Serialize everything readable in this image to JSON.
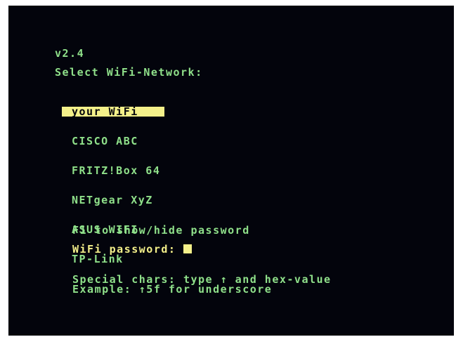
{
  "version": "v2.4",
  "heading": "Select WiFi-Network:",
  "networks": [
    {
      "name": "your WiFi",
      "selected": true
    },
    {
      "name": "CISCO ABC",
      "selected": false
    },
    {
      "name": "FRITZ!Box 64",
      "selected": false
    },
    {
      "name": "NETgear XyZ",
      "selected": false
    },
    {
      "name": "ASUS WIFI",
      "selected": false
    },
    {
      "name": "TP-Link",
      "selected": false
    }
  ],
  "hint_toggle": "F1 to show/hide password",
  "password_label": "WiFi password:",
  "password_value": "",
  "help_line_1": "Special chars: type ↑ and hex-value",
  "help_line_2": "Example: ↑5f for underscore",
  "colors": {
    "background": "#03040c",
    "text_green": "#8fe08a",
    "highlight_yellow": "#f4f08a"
  }
}
